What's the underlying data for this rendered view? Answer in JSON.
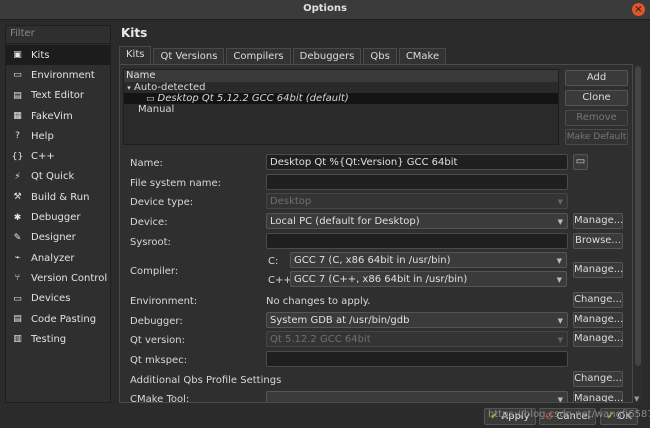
{
  "window": {
    "title": "Options"
  },
  "sidebar": {
    "filter_placeholder": "Filter",
    "items": [
      {
        "label": "Kits",
        "icon": "kits-icon",
        "glyph": "▣"
      },
      {
        "label": "Environment",
        "icon": "monitor-icon",
        "glyph": "▭"
      },
      {
        "label": "Text Editor",
        "icon": "text-editor-icon",
        "glyph": "▤"
      },
      {
        "label": "FakeVim",
        "icon": "fakevim-icon",
        "glyph": "▦"
      },
      {
        "label": "Help",
        "icon": "help-icon",
        "glyph": "?"
      },
      {
        "label": "C++",
        "icon": "cpp-icon",
        "glyph": "{}"
      },
      {
        "label": "Qt Quick",
        "icon": "qt-quick-icon",
        "glyph": "⚡"
      },
      {
        "label": "Build & Run",
        "icon": "hammer-icon",
        "glyph": "⚒"
      },
      {
        "label": "Debugger",
        "icon": "debugger-icon",
        "glyph": "✱"
      },
      {
        "label": "Designer",
        "icon": "pencil-icon",
        "glyph": "✎"
      },
      {
        "label": "Analyzer",
        "icon": "analyzer-icon",
        "glyph": "⌁"
      },
      {
        "label": "Version Control",
        "icon": "version-control-icon",
        "glyph": "⑂"
      },
      {
        "label": "Devices",
        "icon": "devices-icon",
        "glyph": "▭"
      },
      {
        "label": "Code Pasting",
        "icon": "clipboard-icon",
        "glyph": "▤"
      },
      {
        "label": "Testing",
        "icon": "testing-icon",
        "glyph": "▥"
      }
    ]
  },
  "main": {
    "heading": "Kits",
    "tabs": [
      "Kits",
      "Qt Versions",
      "Compilers",
      "Debuggers",
      "Qbs",
      "CMake"
    ],
    "tree": {
      "header": "Name",
      "auto_detected": "Auto-detected",
      "kit": "Desktop Qt 5.12.2 GCC 64bit (default)",
      "manual": "Manual"
    },
    "side_buttons": {
      "add": "Add",
      "clone": "Clone",
      "remove": "Remove",
      "make_default": "Make Default"
    },
    "form": {
      "name_label": "Name:",
      "name_value": "Desktop Qt %{Qt:Version} GCC 64bit",
      "fs_name_label": "File system name:",
      "device_type_label": "Device type:",
      "device_type_value": "Desktop",
      "device_label": "Device:",
      "device_value": "Local PC (default for Desktop)",
      "sysroot_label": "Sysroot:",
      "compiler_label": "Compiler:",
      "compiler_c_label": "C:",
      "compiler_c_value": "GCC 7 (C, x86 64bit in /usr/bin)",
      "compiler_cpp_label": "C++:",
      "compiler_cpp_value": "GCC 7 (C++, x86 64bit in /usr/bin)",
      "environment_label": "Environment:",
      "environment_value": "No changes to apply.",
      "debugger_label": "Debugger:",
      "debugger_value": "System GDB at /usr/bin/gdb",
      "qt_version_label": "Qt version:",
      "qt_version_value": "Qt 5.12.2 GCC 64bit",
      "qt_mkspec_label": "Qt mkspec:",
      "qbs_label": "Additional Qbs Profile Settings",
      "cmake_tool_label": "CMake Tool:",
      "manage": "Manage...",
      "browse": "Browse...",
      "change": "Change..."
    }
  },
  "footer": {
    "apply": "Apply",
    "cancel": "Cancel",
    "ok": "OK",
    "watermark": "https://blog.csdn.net/wangfj6587"
  }
}
